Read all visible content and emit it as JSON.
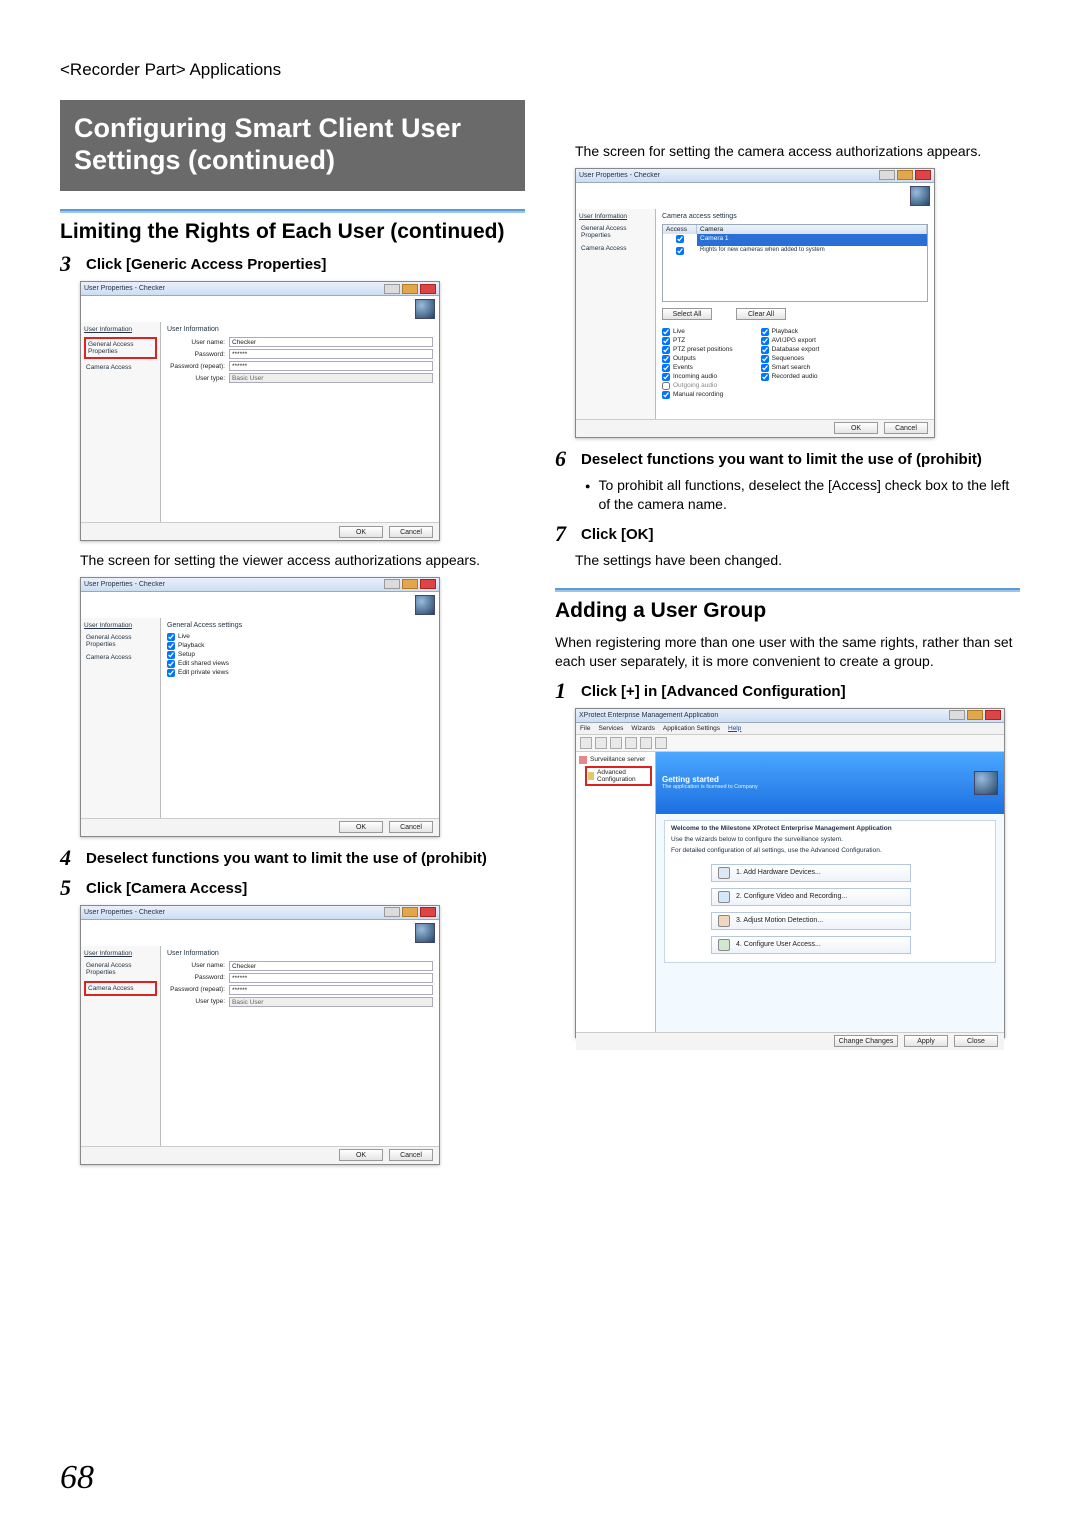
{
  "breadcrumb": "<Recorder Part> Applications",
  "page_number": "68",
  "title": "Configuring Smart Client User Settings (continued)",
  "left": {
    "h2": "Limiting the Rights of Each User (continued)",
    "step3_num": "3",
    "step3_label": "Click [Generic Access Properties]",
    "after_step3_text": "The screen for setting the viewer access authorizations appears.",
    "step4_num": "4",
    "step4_label": "Deselect functions you want to limit the use of (prohibit)",
    "step5_num": "5",
    "step5_label": "Click [Camera Access]"
  },
  "right": {
    "lead_text": "The screen for setting the camera access authorizations appears.",
    "step6_num": "6",
    "step6_label": "Deselect functions you want to limit the use of (prohibit)",
    "step6_bullet": "To prohibit all functions, deselect the [Access] check box to the left of the camera name.",
    "step7_num": "7",
    "step7_label": "Click [OK]",
    "step7_text": "The settings have been changed.",
    "h2": "Adding a User Group",
    "h2_text": "When registering more than one user with the same rights, rather than set each user separately, it is more convenient to create a group.",
    "step1_num": "1",
    "step1_label": "Click [+] in [Advanced Configuration]"
  },
  "dlg": {
    "title": "User Properties - Checker",
    "side_user_info": "User Information",
    "side_generic": "General Access Properties",
    "side_camera": "Camera Access",
    "sec_user_info": "User Information",
    "lbl_username": "User name:",
    "lbl_password": "Password:",
    "lbl_password_repeat": "Password (repeat):",
    "lbl_usertype": "User type:",
    "val_username": "Checker",
    "val_masked": "******",
    "val_usertype": "Basic User",
    "btn_ok": "OK",
    "btn_cancel": "Cancel"
  },
  "viewer": {
    "sec_title": "General Access settings",
    "cb_live": "Live",
    "cb_playback": "Playback",
    "cb_setup": "Setup",
    "cb_edit_shared": "Edit shared views",
    "cb_edit_private": "Edit private views"
  },
  "cam": {
    "sec_title": "Camera access settings",
    "th_access": "Access",
    "th_camera": "Camera",
    "row_camera": "Camera 1",
    "row_note": "Rights for new cameras when added to system",
    "btn_select_all": "Select All",
    "btn_clear_all": "Clear All",
    "cb": {
      "live": "Live",
      "ptz": "PTZ",
      "ptz_preset": "PTZ preset positions",
      "outputs": "Outputs",
      "events": "Events",
      "incoming_audio": "Incoming audio",
      "outgoing_audio": "Outgoing audio",
      "manual_recording": "Manual recording",
      "playback": "Playback",
      "avi_jpg": "AVI/JPG export",
      "db_export": "Database export",
      "sequences": "Sequences",
      "smart_search": "Smart search",
      "recorded_audio": "Recorded audio"
    }
  },
  "mgmt": {
    "title": "XProtect Enterprise Management Application",
    "menus": {
      "file": "File",
      "services": "Services",
      "wizards": "Wizards",
      "app": "Application Settings",
      "help": "Help"
    },
    "tree": {
      "root": "Surveillance server",
      "adv": "Advanced Configuration"
    },
    "hero_hello": "Getting started",
    "hero_sub": "The application is licensed to Company",
    "panel_title": "Welcome to the Milestone XProtect Enterprise Management Application",
    "panel_line1": "Use the wizards below to configure the surveillance system.",
    "panel_line2": "For detailed configuration of all settings, use the Advanced Configuration.",
    "act1": "1. Add Hardware Devices...",
    "act2": "2. Configure Video and Recording...",
    "act3": "3. Adjust Motion Detection...",
    "act4": "4. Configure User Access...",
    "btn_change": "Change Changes",
    "btn_apply": "Apply",
    "btn_close": "Close"
  }
}
